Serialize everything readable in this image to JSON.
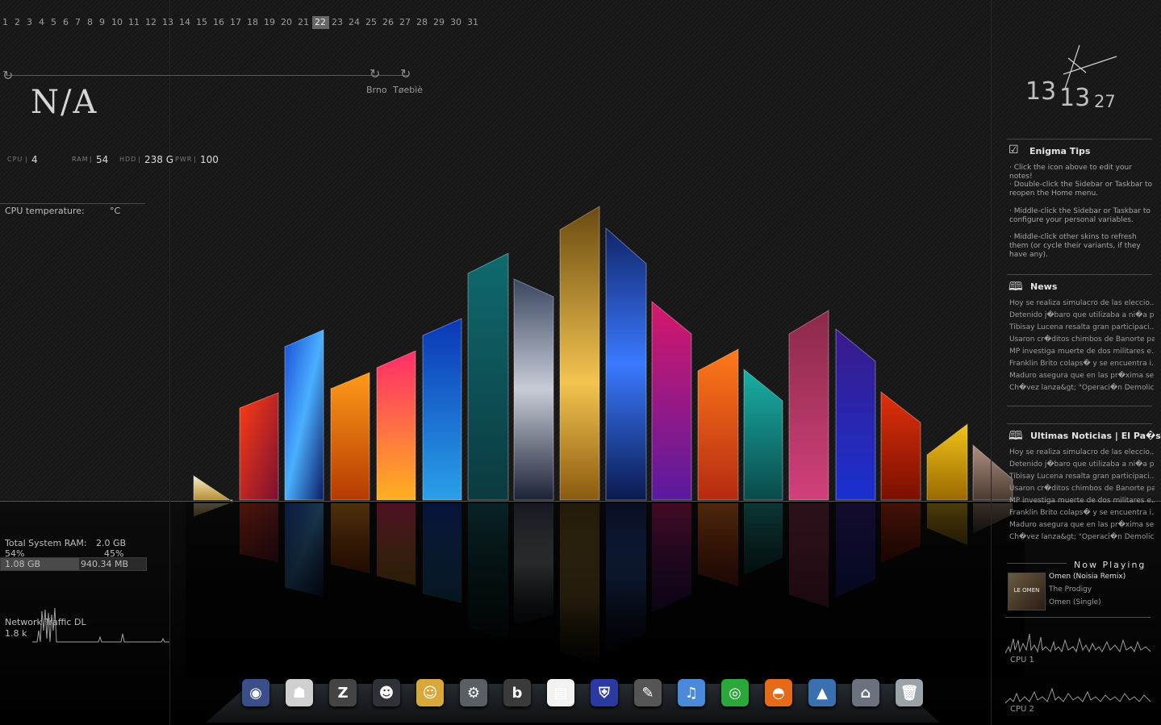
{
  "calendar": {
    "days": [
      "1",
      "2",
      "3",
      "4",
      "5",
      "6",
      "7",
      "8",
      "9",
      "10",
      "11",
      "12",
      "13",
      "14",
      "15",
      "16",
      "17",
      "18",
      "19",
      "20",
      "21",
      "22",
      "23",
      "24",
      "25",
      "26",
      "27",
      "28",
      "29",
      "30",
      "31"
    ],
    "today": "22"
  },
  "weather": {
    "current": "N/A",
    "cities": [
      "Brno",
      "Tøebìè"
    ]
  },
  "system": {
    "cpu_label": "CPU",
    "cpu": "4",
    "ram_label": "RAM",
    "ram": "54",
    "hdd_label": "HDD",
    "hdd": "238 G",
    "pwr_label": "PWR",
    "pwr": "100"
  },
  "cpu_temp": {
    "label": "CPU temperature:",
    "unit": "°C"
  },
  "ram_meter": {
    "label": "Total System RAM:",
    "total": "2.0 GB",
    "used_pct": "54%",
    "free_pct": "45%",
    "used": "1.08 GB",
    "free": "940.34 MB",
    "used_fraction": 0.54
  },
  "network": {
    "label": "Network Traffic DL",
    "value": "1.8 k"
  },
  "clock": {
    "hour": "13",
    "minute": "13",
    "second": "27"
  },
  "tips": {
    "title": "Enigma Tips",
    "items": [
      "· Click the icon above to edit your notes!",
      "· Double-click the Sidebar or Taskbar to reopen the Home menu.",
      "· Middle-click the Sidebar or Taskbar to configure your personal variables.",
      "· Middle-click other skins to refresh them (or cycle their variants, if they have any)."
    ]
  },
  "news": {
    "title": "News",
    "items": [
      "Hoy se realiza simulacro de las eleccio...",
      "Detenido j�baro que utilizaba a ni�a p...",
      "Tibisay Lucena resalta gran participaci...",
      "Usaron cr�ditos chimbos de Banorte pa...",
      "MP investiga muerte de dos militares e...",
      "Franklin Brito colaps� y se encuentra i...",
      "Maduro asegura que en las pr�xima se...",
      "Ch�vez lanza&gt; \"Operaci�n Demolic..."
    ]
  },
  "news2": {
    "title": "Ultimas Noticias | El Pa�s",
    "items": [
      "Hoy se realiza simulacro de las eleccio...",
      "Detenido j�baro que utilizaba a ni�a p...",
      "Tibisay Lucena resalta gran participaci...",
      "Usaron cr�ditos chimbos de Banorte pa...",
      "MP investiga muerte de dos militares e...",
      "Franklin Brito colaps� y se encuentra i...",
      "Maduro asegura que en las pr�xima se...",
      "Ch�vez lanza&gt; \"Operaci�n Demolic..."
    ]
  },
  "now_playing": {
    "header": "Now Playing",
    "title": "Omen (Noisia Remix)",
    "artist": "The Prodigy",
    "album": "Omen (Single)",
    "art_text": "LE OMEN"
  },
  "cpu_graphs": {
    "cpu1": "CPU 1",
    "cpu2": "CPU 2"
  },
  "dock": {
    "items": [
      {
        "name": "game-icon",
        "glyph": "◉",
        "color": "#3a4f8a"
      },
      {
        "name": "clone-trooper-icon",
        "glyph": "☗",
        "color": "#d0d0d0"
      },
      {
        "name": "need-for-speed-icon",
        "glyph": "Z",
        "color": "#444"
      },
      {
        "name": "soldier-game-icon",
        "glyph": "☻",
        "color": "#2e3238"
      },
      {
        "name": "fallout-icon",
        "glyph": "☺",
        "color": "#d8a93a"
      },
      {
        "name": "steam-icon",
        "glyph": "⚙",
        "color": "#5a5f66"
      },
      {
        "name": "b-app-icon",
        "glyph": "b",
        "color": "#3a3a3a"
      },
      {
        "name": "pes-game-icon",
        "glyph": "▤",
        "color": "#f2f2f2"
      },
      {
        "name": "shield-game-icon",
        "glyph": "⛨",
        "color": "#2a3aa0"
      },
      {
        "name": "gimp-icon",
        "glyph": "✎",
        "color": "#555"
      },
      {
        "name": "itunes-icon",
        "glyph": "♫",
        "color": "#4a8ad8"
      },
      {
        "name": "bittorrent-icon",
        "glyph": "◎",
        "color": "#2aa83a"
      },
      {
        "name": "firefox-icon",
        "glyph": "◓",
        "color": "#e56a1a"
      },
      {
        "name": "arch-icon",
        "glyph": "▲",
        "color": "#3a6fb0"
      },
      {
        "name": "home-icon",
        "glyph": "⌂",
        "color": "#6a7280"
      },
      {
        "name": "recycle-bin-icon",
        "glyph": "🗑",
        "color": "#9aa2aa"
      }
    ]
  },
  "colors": {
    "accent": "#dcdcdc",
    "panel": "#141414"
  }
}
